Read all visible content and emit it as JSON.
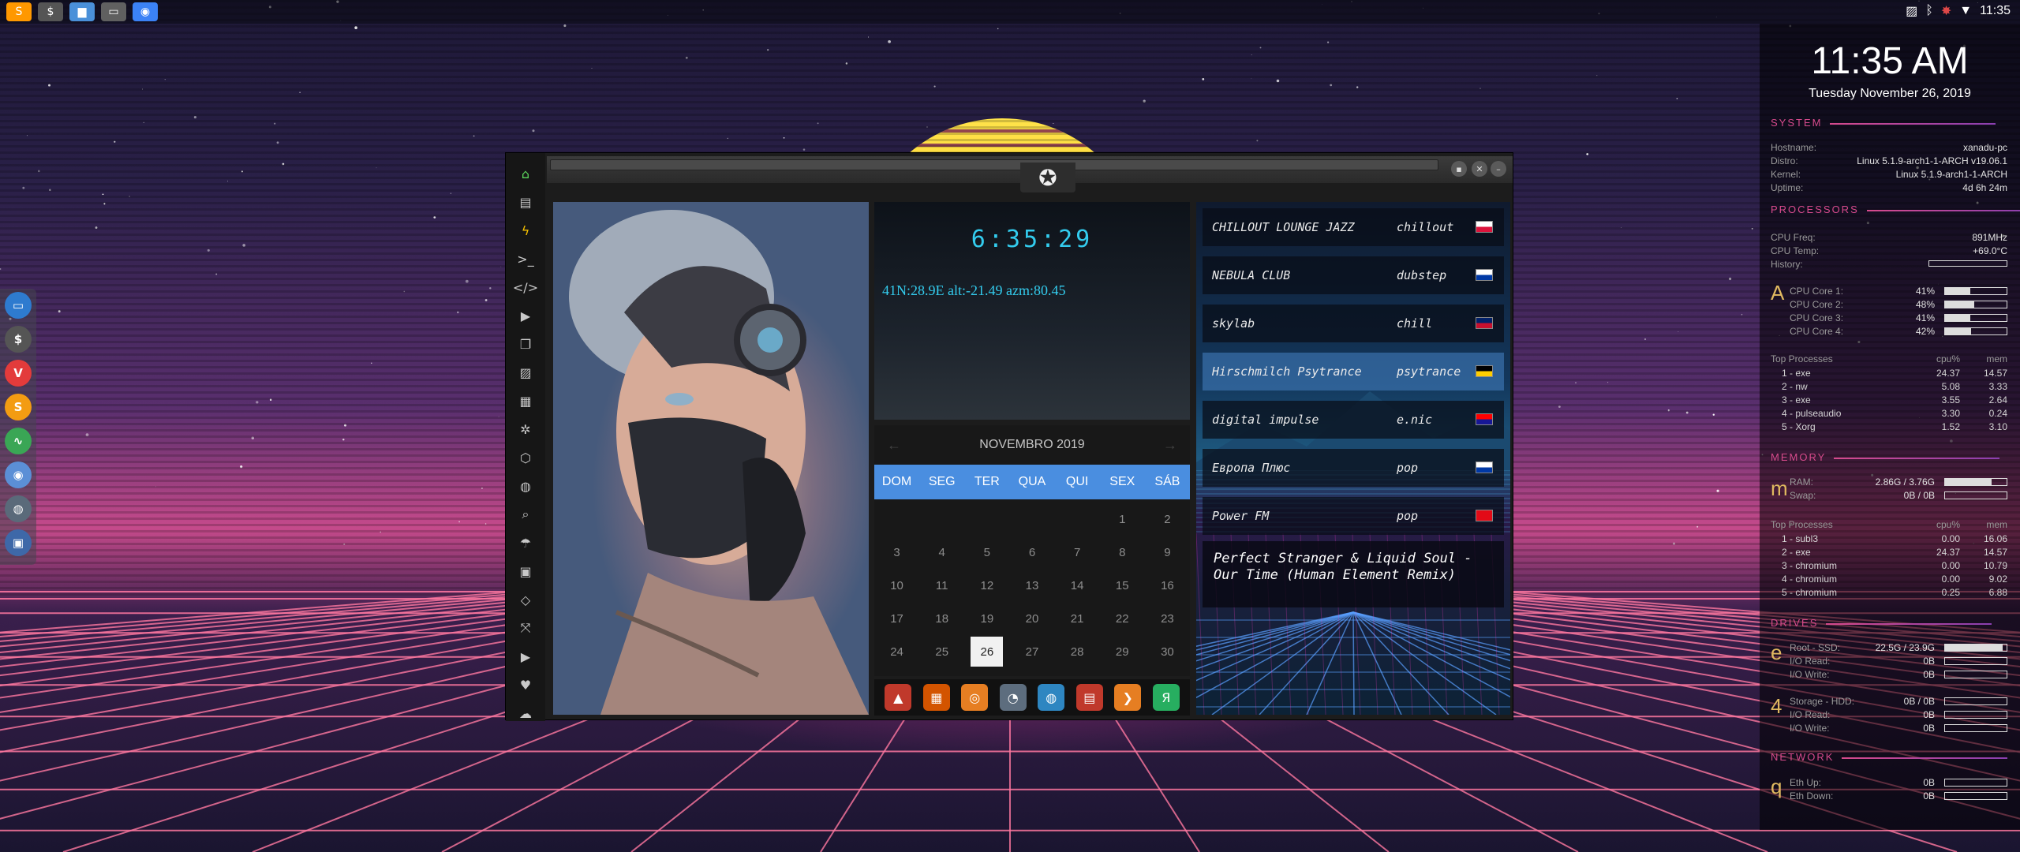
{
  "topbar": {
    "apps": [
      {
        "icon": "sublime-icon",
        "glyph": "S",
        "color": "#ff9800"
      },
      {
        "icon": "terminal-icon",
        "glyph": "$",
        "color": "#555555"
      },
      {
        "icon": "folder-icon",
        "glyph": "▆",
        "color": "#4a90d9"
      },
      {
        "icon": "window-icon",
        "glyph": "▭",
        "color": "#606060"
      },
      {
        "icon": "chromium-icon",
        "glyph": "◉",
        "color": "#3b82f6"
      }
    ],
    "time": "11:35"
  },
  "leftdock": [
    {
      "icon": "app-window-icon",
      "glyph": "▭",
      "color": "#2e7bcf"
    },
    {
      "icon": "terminal-icon",
      "glyph": "$",
      "color": "#555555"
    },
    {
      "icon": "vivaldi-icon",
      "glyph": "V",
      "color": "#e33b3b"
    },
    {
      "icon": "sublime-icon",
      "glyph": "S",
      "color": "#f39c12"
    },
    {
      "icon": "monitor-icon",
      "glyph": "∿",
      "color": "#3aa655"
    },
    {
      "icon": "chromium-icon",
      "glyph": "◉",
      "color": "#5b8fd6"
    },
    {
      "icon": "globe-icon",
      "glyph": "◍",
      "color": "#5a6a7a"
    },
    {
      "icon": "screenshot-icon",
      "glyph": "▣",
      "color": "#3e68a8"
    }
  ],
  "window": {
    "sidebar_icons": [
      "home-icon",
      "file-icon",
      "bolt-icon",
      "terminal-icon",
      "code-icon",
      "play-icon",
      "copy-icon",
      "image-icon",
      "news-icon",
      "aperture-icon",
      "hexagon-icon",
      "globe-icon",
      "search-icon",
      "umbrella-icon",
      "contact-icon",
      "tag-icon",
      "expand-icon",
      "youtube-icon",
      "heart-icon",
      "cloud-icon"
    ],
    "logo": "rebel-alliance-icon"
  },
  "clock": {
    "time": "6:35:29",
    "coords": "41N:28.9E  alt:-21.49 azm:80.45"
  },
  "calendar": {
    "month": "NOVEMBRO 2019",
    "prev": "←",
    "next": "→",
    "dows": [
      "DOM",
      "SEG",
      "TER",
      "QUA",
      "QUI",
      "SEX",
      "SÁB"
    ],
    "days": [
      "",
      "",
      "",
      "",
      "",
      "1",
      "2",
      "3",
      "4",
      "5",
      "6",
      "7",
      "8",
      "9",
      "10",
      "11",
      "12",
      "13",
      "14",
      "15",
      "16",
      "17",
      "18",
      "19",
      "20",
      "21",
      "22",
      "23",
      "24",
      "25",
      "26",
      "27",
      "28",
      "29",
      "30"
    ],
    "today": "26"
  },
  "appdock": [
    {
      "icon": "arch-icon",
      "glyph": "▲",
      "color": "#c0392b"
    },
    {
      "icon": "calendar-app-icon",
      "glyph": "▦",
      "color": "#d35400"
    },
    {
      "icon": "magnifier-icon",
      "glyph": "◎",
      "color": "#e67e22"
    },
    {
      "icon": "clock-icon",
      "glyph": "◔",
      "color": "#5d6d7e"
    },
    {
      "icon": "globe-icon",
      "glyph": "◍",
      "color": "#2e86c1"
    },
    {
      "icon": "calendar-clock-icon",
      "glyph": "▤",
      "color": "#c0392b"
    },
    {
      "icon": "arrow-icon",
      "glyph": "❯",
      "color": "#e67e22"
    },
    {
      "icon": "yandex-icon",
      "glyph": "Я",
      "color": "#27ae60"
    }
  ],
  "radio": {
    "stations": [
      {
        "name": "CHILLOUT LOUNGE JAZZ",
        "genre": "chillout",
        "flag": "flag-poland-icon",
        "f1": "#ffffff",
        "f2": "#dc143c"
      },
      {
        "name": "NEBULA CLUB",
        "genre": "dubstep",
        "flag": "flag-russia-icon",
        "f1": "#ffffff",
        "f2": "#0039a6"
      },
      {
        "name": "skylab",
        "genre": "chill",
        "flag": "flag-uk-icon",
        "f1": "#012169",
        "f2": "#c8102e"
      },
      {
        "name": "Hirschmilch Psytrance",
        "genre": "psytrance",
        "flag": "flag-germany-icon",
        "f1": "#000000",
        "f2": "#ffce00"
      },
      {
        "name": "digital impulse",
        "genre": "e.nic",
        "flag": "flag-croatia-icon",
        "f1": "#ff0000",
        "f2": "#171796"
      },
      {
        "name": "Европа Плюс",
        "genre": "pop",
        "flag": "flag-russia-icon",
        "f1": "#ffffff",
        "f2": "#0039a6"
      },
      {
        "name": "Power FM",
        "genre": "pop",
        "flag": "flag-turkey-icon",
        "f1": "#e30a17",
        "f2": "#e30a17"
      }
    ],
    "now_playing_1": "Perfect Stranger & Liquid Soul -",
    "now_playing_2": "Our Time (Human Element Remix)"
  },
  "conky": {
    "time": "11:35 AM",
    "date": "Tuesday November 26, 2019",
    "system": {
      "title": "SYSTEM",
      "rows": [
        {
          "k": "Hostname:",
          "v": "xanadu-pc"
        },
        {
          "k": "Distro:",
          "v": "Linux 5.1.9-arch1-1-ARCH v19.06.1"
        },
        {
          "k": "Kernel:",
          "v": "Linux 5.1.9-arch1-1-ARCH"
        },
        {
          "k": "Uptime:",
          "v": "4d 6h 24m"
        }
      ]
    },
    "processors": {
      "title": "PROCESSORS",
      "freq_k": "CPU Freq:",
      "freq_v": "891MHz",
      "temp_k": "CPU Temp:",
      "temp_v": "+69.0°C",
      "hist_k": "History:",
      "letter": "A",
      "cores": [
        {
          "k": "CPU Core 1:",
          "v": "41%",
          "pct": 41
        },
        {
          "k": "CPU Core 2:",
          "v": "48%",
          "pct": 48
        },
        {
          "k": "CPU Core 3:",
          "v": "41%",
          "pct": 41
        },
        {
          "k": "CPU Core 4:",
          "v": "42%",
          "pct": 42
        }
      ],
      "top_title": "Top Processes",
      "col_cpu": "cpu%",
      "col_mem": "mem",
      "top": [
        {
          "n": "1 - exe",
          "c": "24.37",
          "m": "14.57"
        },
        {
          "n": "2 - nw",
          "c": "5.08",
          "m": "3.33"
        },
        {
          "n": "3 - exe",
          "c": "3.55",
          "m": "2.64"
        },
        {
          "n": "4 - pulseaudio",
          "c": "3.30",
          "m": "0.24"
        },
        {
          "n": "5 - Xorg",
          "c": "1.52",
          "m": "3.10"
        }
      ]
    },
    "memory": {
      "title": "MEMORY",
      "letter": "m",
      "ram_k": "RAM:",
      "ram_v": "2.86G / 3.76G",
      "ram_pct": 76,
      "swap_k": "Swap:",
      "swap_v": "0B / 0B",
      "swap_pct": 0,
      "top_title": "Top Processes",
      "col_cpu": "cpu%",
      "col_mem": "mem",
      "top": [
        {
          "n": "1 - subl3",
          "c": "0.00",
          "m": "16.06"
        },
        {
          "n": "2 - exe",
          "c": "24.37",
          "m": "14.57"
        },
        {
          "n": "3 - chromium",
          "c": "0.00",
          "m": "10.79"
        },
        {
          "n": "4 - chromium",
          "c": "0.00",
          "m": "9.02"
        },
        {
          "n": "5 - chromium",
          "c": "0.25",
          "m": "6.88"
        }
      ]
    },
    "drives": {
      "title": "DRIVES",
      "l1": "e",
      "root_k": "Root - SSD:",
      "root_v": "22.5G / 23.9G",
      "root_pct": 94,
      "ior1_k": "I/O Read:",
      "ior1_v": "0B",
      "iow1_k": "I/O Write:",
      "iow1_v": "0B",
      "l2": "4",
      "stor_k": "Storage - HDD:",
      "stor_v": "0B / 0B",
      "stor_pct": 0,
      "ior2_k": "I/O Read:",
      "ior2_v": "0B",
      "iow2_k": "I/O Write:",
      "iow2_v": "0B"
    },
    "network": {
      "title": "NETWORK",
      "letter": "q",
      "up_k": "Eth Up:",
      "up_v": "0B",
      "down_k": "Eth Down:",
      "down_v": "0B"
    }
  }
}
